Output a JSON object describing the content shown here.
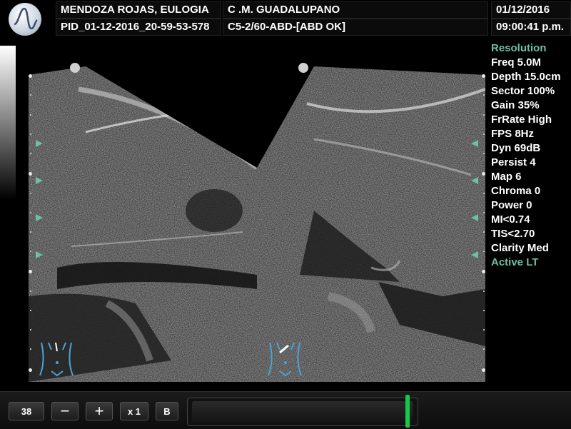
{
  "header": {
    "patient_name": "MENDOZA ROJAS, EULOGIA",
    "patient_id": "PID_01-12-2016_20-59-53-578",
    "institution": "C .M. GUADALUPANO",
    "probe_preset": "C5-2/60-ABD-[ABD OK]",
    "date": "01/12/2016",
    "time": "09:00:41 p.m."
  },
  "params": [
    {
      "label": "Resolution",
      "accent": true
    },
    {
      "label": "Freq 5.0M"
    },
    {
      "label": "Depth 15.0cm"
    },
    {
      "label": "Sector 100%"
    },
    {
      "label": "Gain 35%"
    },
    {
      "label": "FrRate High"
    },
    {
      "label": "FPS 8Hz"
    },
    {
      "label": "Dyn 69dB"
    },
    {
      "label": "Persist 4"
    },
    {
      "label": "Map 6"
    },
    {
      "label": "Chroma 0"
    },
    {
      "label": "Power 0"
    },
    {
      "label": "MI<0.74"
    },
    {
      "label": "TIS<2.70"
    },
    {
      "label": "Clarity Med"
    },
    {
      "label": "Active LT",
      "accent": true
    }
  ],
  "footer": {
    "value_field": "38",
    "minus_label": "−",
    "plus_label": "+",
    "zoom_label": "x 1",
    "b_label": "B",
    "cine_position": 0.97
  },
  "colors": {
    "accent": "#6fbfa3",
    "slider_thumb": "#19c84a"
  },
  "icons": [
    "app-logo-icon",
    "body-mark-icon",
    "orientation-marker-icon"
  ]
}
